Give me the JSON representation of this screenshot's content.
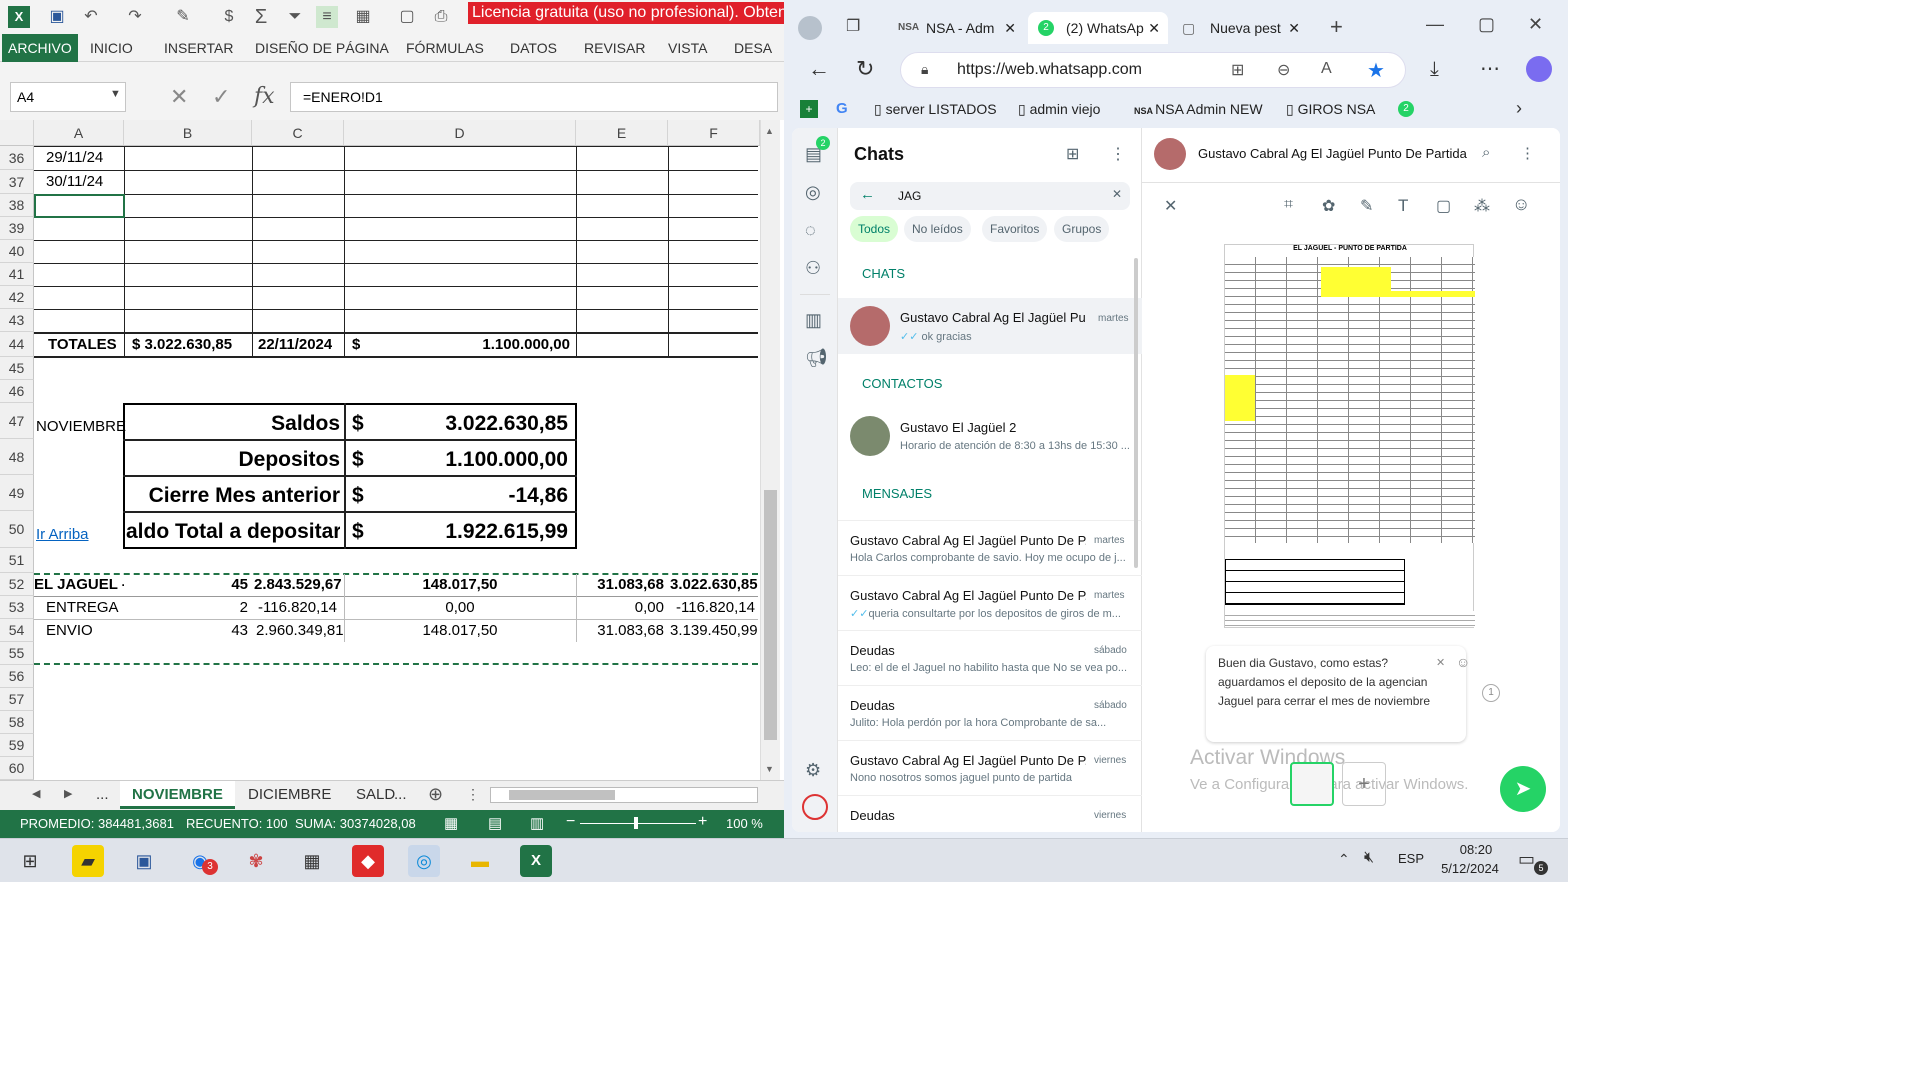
{
  "excel": {
    "license_banner": "Licencia gratuita (uso no profesional). Obtener una licencia de prueba o comprar",
    "ribbon_tabs": [
      "ARCHIVO",
      "INICIO",
      "INSERTAR",
      "DISEÑO DE PÁGINA",
      "FÓRMULAS",
      "DATOS",
      "REVISAR",
      "VISTA",
      "DESA"
    ],
    "name_box": "A4",
    "formula": "=ENERO!D1",
    "columns": [
      "A",
      "B",
      "C",
      "D",
      "E",
      "F"
    ],
    "rows": [
      "36",
      "37",
      "38",
      "39",
      "40",
      "41",
      "42",
      "43",
      "44",
      "45",
      "46",
      "47",
      "48",
      "49",
      "50",
      "51",
      "52",
      "53",
      "54",
      "55",
      "56",
      "57",
      "58",
      "59",
      "60"
    ],
    "cells": {
      "a36": "29/11/24",
      "a37": "30/11/24",
      "a44": "TOTALES",
      "b44": "$ 3.022.630,85",
      "c44": "22/11/2024",
      "d44_sign": "$",
      "d44": "1.100.000,00",
      "a47": "NOVIEMBRE",
      "a50": "Ir Arriba",
      "a52": "EL JAGUEL - I",
      "b52": "45",
      "c52": "2.843.529,67",
      "d52": "148.017,50",
      "e52": "31.083,68",
      "f52": "3.022.630,85",
      "a53": "ENTREGA",
      "b53": "2",
      "c53": "-116.820,14",
      "d53": "0,00",
      "e53": "0,00",
      "f53": "-116.820,14",
      "a54": "ENVIO",
      "b54": "43",
      "c54": "2.960.349,81",
      "d54": "148.017,50",
      "e54": "31.083,68",
      "f54": "3.139.450,99"
    },
    "summary": [
      {
        "label": "Saldos",
        "sign": "$",
        "value": "3.022.630,85"
      },
      {
        "label": "Depositos",
        "sign": "$",
        "value": "1.100.000,00"
      },
      {
        "label": "Cierre Mes anterior",
        "sign": "$",
        "value": "-14,86"
      },
      {
        "label": "aldo Total a depositar",
        "sign": "$",
        "value": "1.922.615,99"
      }
    ],
    "sheet_tabs": [
      "...",
      "NOVIEMBRE",
      "DICIEMBRE",
      "SALD",
      "..."
    ],
    "status": {
      "promedio": "PROMEDIO: 384481,3681",
      "recuento": "RECUENTO: 100",
      "suma": "SUMA: 30374028,08",
      "zoom": "100 %"
    }
  },
  "browser": {
    "tabs": [
      {
        "label": "NSA - Adm",
        "badge": ""
      },
      {
        "label": "(2) WhatsAp",
        "badge": "2"
      },
      {
        "label": "Nueva pest",
        "badge": ""
      }
    ],
    "url": "https://web.whatsapp.com",
    "bookmarks": [
      "server LISTADOS",
      "admin viejo",
      "NSA Admin NEW",
      "GIROS NSA"
    ],
    "bookmark_badge": "2"
  },
  "whatsapp": {
    "rail_badge": "2",
    "header": "Chats",
    "search_value": "JAG",
    "filters": [
      "Todos",
      "No leídos",
      "Favoritos",
      "Grupos"
    ],
    "sections": {
      "chats": "CHATS",
      "contacts": "CONTACTOS",
      "messages": "MENSAJES"
    },
    "chat_results": [
      {
        "name": "Gustavo Cabral Ag El Jagüel Pu...",
        "time": "martes",
        "msg": "ok gracias"
      }
    ],
    "contact_results": [
      {
        "name": "Gustavo El Jagüel 2",
        "msg": "Horario de atención de 8:30 a 13hs de 15:30 ..."
      }
    ],
    "message_results": [
      {
        "name": "Gustavo Cabral Ag El Jagüel Punto De P...",
        "time": "martes",
        "msg": "Hola Carlos comprobante de savio. Hoy me ocupo de j..."
      },
      {
        "name": "Gustavo Cabral Ag El Jagüel Punto De P...",
        "time": "martes",
        "msg": "queria consultarte por los depositos de giros de m..."
      },
      {
        "name": "Deudas",
        "time": "sábado",
        "msg": "Leo: el de el Jaguel no habilito hasta que No se vea po..."
      },
      {
        "name": "Deudas",
        "time": "sábado",
        "msg": "Julito: Hola perdón por la hora  Comprobante de sa..."
      },
      {
        "name": "Gustavo Cabral Ag El Jagüel Punto De P...",
        "time": "viernes",
        "msg": "Nono nosotros somos jaguel punto de partida"
      },
      {
        "name": "Deudas",
        "time": "viernes",
        "msg": ""
      }
    ],
    "preview_title": "Gustavo Cabral Ag El Jagüel Punto De Partida",
    "thumb_title": "EL JAGUEL - PUNTO DE PARTIDA",
    "caption": "Buen dia Gustavo, como estas? aguardamos el deposito de la agencian Jaguel para cerrar el mes de noviembre",
    "watermark_line1": "Activar Windows",
    "watermark_line2": "Ve a Configuración para activar Windows."
  },
  "taskbar": {
    "lang": "ESP",
    "time": "08:20",
    "date": "5/12/2024",
    "badge_chrome": "3",
    "notif": "5"
  }
}
